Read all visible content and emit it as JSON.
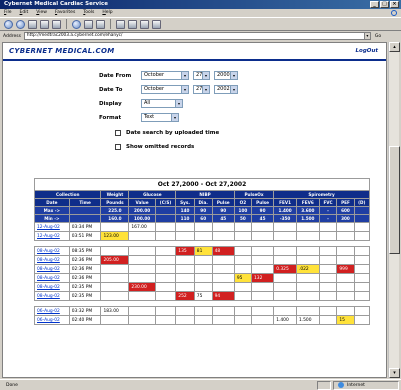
{
  "window": {
    "title": "Cybernet Medical Cardiac Service",
    "buttons": [
      "_",
      "□",
      "×"
    ]
  },
  "menu": [
    "File",
    "Edit",
    "View",
    "Favorites",
    "Tools",
    "Help"
  ],
  "address": {
    "label": "Address",
    "url": "http://medtrac2003.a.cybernet.com/ehanyc/",
    "go": "Go"
  },
  "site": {
    "logo": "CYBERNET MEDICAL.COM",
    "logout": "LogOut"
  },
  "form": {
    "date_from_label": "Date From",
    "date_from_month": "October",
    "date_from_day": "27",
    "date_from_year": "2000",
    "date_to_label": "Date To",
    "date_to_month": "October",
    "date_to_day": "27",
    "date_to_year": "2002",
    "display_label": "Display",
    "display_value": "All",
    "format_label": "Format",
    "format_value": "Text",
    "check1": "Date search by uploaded time",
    "check2": "Show omitted records"
  },
  "report": {
    "range_title": "Oct 27,2000 - Oct 27,2002",
    "groups": [
      "Collection",
      "Weight",
      "Glucose",
      "NIBP",
      "PulseOx",
      "Spirometry"
    ],
    "columns": [
      "Date",
      "Time",
      "Pounds",
      "Value",
      "(C/S)",
      "Sys.",
      "Dia.",
      "Pulse",
      "O2",
      "Pulse",
      "FEV1",
      "FEV6",
      "FVC",
      "PEF",
      "(D)"
    ],
    "max_row": [
      "Max ->",
      "",
      "225.0",
      "200.00",
      "",
      "140",
      "90",
      "90",
      "100",
      "90",
      "1.400",
      "3.600",
      "-",
      "600",
      ""
    ],
    "min_row": [
      "Min ->",
      "",
      "160.0",
      "100.00",
      "",
      "110",
      "60",
      "45",
      "50",
      "45",
      "-350",
      "1.500",
      "-",
      "300",
      ""
    ],
    "rows": [
      {
        "date": "12-Aug-02",
        "time": "03:34 PM",
        "cells": [
          "",
          "167.00",
          "",
          "",
          "",
          "",
          "",
          "",
          "",
          "",
          "",
          "",
          ""
        ]
      },
      {
        "date": "12-Aug-02",
        "time": "03:51 PM",
        "cells": [
          "123.00",
          "",
          "",
          "",
          "",
          "",
          "",
          "",
          "",
          "",
          "",
          "",
          ""
        ]
      },
      {
        "date": "08-Aug-02",
        "time": "08:35 PM",
        "cells": [
          "",
          "",
          "",
          "135",
          "81",
          "48",
          "",
          "",
          "",
          "",
          "",
          "",
          ""
        ]
      },
      {
        "date": "08-Aug-02",
        "time": "02:36 PM",
        "cells": [
          "205.00",
          "",
          "",
          "",
          "",
          "",
          "",
          "",
          "",
          "",
          "",
          "",
          ""
        ]
      },
      {
        "date": "08-Aug-02",
        "time": "02:36 PM",
        "cells": [
          "",
          "",
          "",
          "",
          "",
          "",
          "",
          "",
          "0.325",
          ".022",
          "",
          "999",
          ""
        ]
      },
      {
        "date": "08-Aug-02",
        "time": "02:36 PM",
        "cells": [
          "",
          "",
          "",
          "",
          "",
          "",
          "95",
          "132",
          "",
          "",
          "",
          "",
          ""
        ]
      },
      {
        "date": "08-Aug-02",
        "time": "02:35 PM",
        "cells": [
          "",
          "230.00",
          "",
          "",
          "",
          "",
          "",
          "",
          "",
          "",
          "",
          "",
          ""
        ]
      },
      {
        "date": "08-Aug-02",
        "time": "02:35 PM",
        "cells": [
          "",
          "",
          "",
          "252",
          "75",
          "94",
          "",
          "",
          "",
          "",
          "",
          "",
          ""
        ]
      },
      {
        "date": "06-Aug-02",
        "time": "03:32 PM",
        "cells": [
          "183.00",
          "",
          "",
          "",
          "",
          "",
          "",
          "",
          "",
          "",
          "",
          "",
          ""
        ]
      },
      {
        "date": "06-Aug-02",
        "time": "02:40 PM",
        "cells": [
          "",
          "",
          "",
          "",
          "",
          "",
          "",
          "",
          "1.400",
          "1.500",
          "",
          "15",
          ""
        ]
      }
    ],
    "highlights": {
      "1-0": "yellow",
      "2-3": "red",
      "2-4": "yellow",
      "2-5": "red",
      "3-0": "red",
      "4-8": "red",
      "4-9": "yellow",
      "4-11": "red",
      "5-6": "yellow",
      "5-7": "red",
      "6-1": "red",
      "7-3": "red",
      "7-5": "red",
      "9-11": "yellow"
    }
  },
  "status": {
    "left": "Done",
    "zone": "Internet"
  }
}
